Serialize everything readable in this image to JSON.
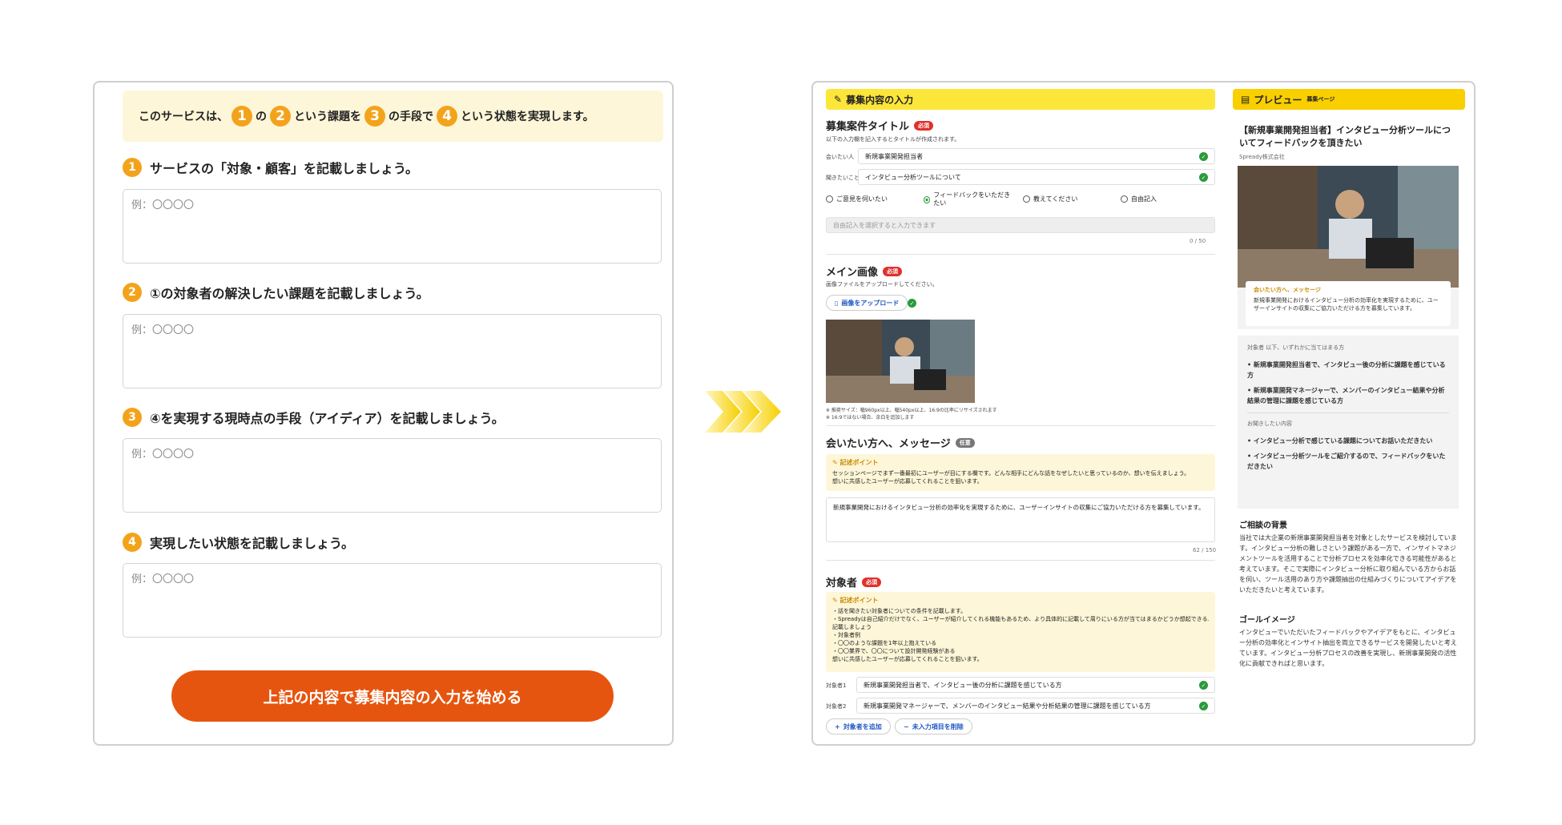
{
  "left": {
    "intro": {
      "p1": "このサービスは、",
      "n1": "1",
      "p2": "の",
      "n2": "2",
      "p3": "という課題を",
      "n3": "3",
      "p4": "の手段で",
      "n4": "4",
      "p5": "という状態を実現します。"
    },
    "questions": [
      {
        "num": "1",
        "label": "サービスの「対象・顧客」を記載しましょう。",
        "placeholder": "例：〇〇〇〇"
      },
      {
        "num": "2",
        "label": "①の対象者の解決したい課題を記載しましょう。",
        "placeholder": "例：〇〇〇〇"
      },
      {
        "num": "3",
        "label": "④を実現する現時点の手段（アイディア）を記載しましょう。",
        "placeholder": "例：〇〇〇〇"
      },
      {
        "num": "4",
        "label": "実現したい状態を記載しましょう。",
        "placeholder": "例：〇〇〇〇"
      }
    ],
    "start_button": "上記の内容で募集内容の入力を始める"
  },
  "form": {
    "header": "募集内容の入力",
    "title_section": {
      "title": "募集案件タイトル",
      "badge": "必須",
      "hint": "以下の入力欄を記入するとタイトルが作成されます。",
      "field1_label": "会いたい人",
      "field1_value": "新規事業開発担当者",
      "field2_label": "聞きたいこと",
      "field2_value": "インタビュー分析ツールについて",
      "radios": [
        "ご意見を伺いたい",
        "フィードバックをいただきたい",
        "教えてください",
        "自由記入"
      ],
      "free_placeholder": "自由記入を選択すると入力できます",
      "counter": "0 / 50"
    },
    "image_section": {
      "title": "メイン画像",
      "badge": "必須",
      "hint": "画像ファイルをアップロードしてください。",
      "upload_label": "画像をアップロード",
      "note1": "※ 推奨サイズ：幅960px以上、幅540px以上、16:9の比率にリサイズされます",
      "note2": "※ 16:9ではない場合、余白を追加します"
    },
    "message_section": {
      "title": "会いたい方へ、メッセージ",
      "badge": "任意",
      "tip_title": "記述ポイント",
      "tip_line1": "セッションページでまず一番最初にユーザーが目にする欄です。どんな相手にどんな話をなぜしたいと思っているのか、想いを伝えましょう。",
      "tip_line2": "想いに共感したユーザーが応募してくれることを狙います。",
      "value": "新規事業開発におけるインタビュー分析の効率化を実現するために、ユーザーインサイトの収集にご協力いただける方を募集しています。",
      "counter": "62 / 150"
    },
    "target_section": {
      "title": "対象者",
      "badge": "必須",
      "tip_title": "記述ポイント",
      "tip_lines": [
        "・話を聞きたい対象者についての条件を記載します。",
        "・Spreadyは自己紹介だけでなく、ユーザーが紹介してくれる機能もあるため、より具体的に記載して周りにいる方が当てはまるかどうか想起できるよう",
        "記載しましょう",
        "・対象者例",
        "・〇〇のような課題を1年以上抱えている",
        "・〇〇業界で、〇〇について設計開発経験がある",
        "想いに共感したユーザーが応募してくれることを狙います。"
      ],
      "t1_label": "対象者1",
      "t1_value": "新規事業開発担当者で、インタビュー後の分析に課題を感じている方",
      "t2_label": "対象者2",
      "t2_value": "新規事業開発マネージャーで、メンバーのインタビュー結果や分析結果の管理に課題を感じている方",
      "add_label": "対象者を追加",
      "remove_label": "未入力項目を削除"
    }
  },
  "preview": {
    "header": "プレビュー",
    "header_sub": "募集ページ",
    "title": "【新規事業開発担当者】インタビュー分析ツールについてフィードバックを頂きたい",
    "company": "Spready株式会社",
    "msg_label": "会いたい方へ、メッセージ",
    "msg_text": "新規事業開発におけるインタビュー分析の効率化を実現するために、ユーザーインサイトの収集にご協力いただける方を募集しています。",
    "target_head": "対象者",
    "target_sub": "以下、いずれかに当てはまる方",
    "targets": [
      "新規事業開発担当者で、インタビュー後の分析に課題を感じている方",
      "新規事業開発マネージャーで、メンバーのインタビュー結果や分析結果の管理に課題を感じている方"
    ],
    "topics_head": "お聞きしたい内容",
    "topics": [
      "インタビュー分析で感じている課題についてお話いただきたい",
      "インタビュー分析ツールをご紹介するので、フィードバックをいただきたい"
    ],
    "bg_title": "ご相談の背景",
    "bg_text": "当社では大企業の新規事業開発担当者を対象としたサービスを検討しています。インタビュー分析の難しさという課題がある一方で、インサイトマネジメントツールを活用することで分析プロセスを効率化できる可能性があると考えています。そこで実際にインタビュー分析に取り組んでいる方からお話を伺い、ツール活用のあり方や課題抽出の仕組みづくりについてアイデアをいただきたいと考えています。",
    "goal_title": "ゴールイメージ",
    "goal_text": "インタビューでいただいたフィードバックやアイデアをもとに、インタビュー分析の効率化とインサイト抽出を両立できるサービスを開発したいと考えています。インタビュー分析プロセスの改善を実現し、新規事業開発の活性化に貢献できればと思います。"
  },
  "colors": {
    "accent": "#f3a31b",
    "button": "#e6550f",
    "header": "#fde63a",
    "tip_bg": "#fdf6d8",
    "check": "#2a9a3a"
  }
}
